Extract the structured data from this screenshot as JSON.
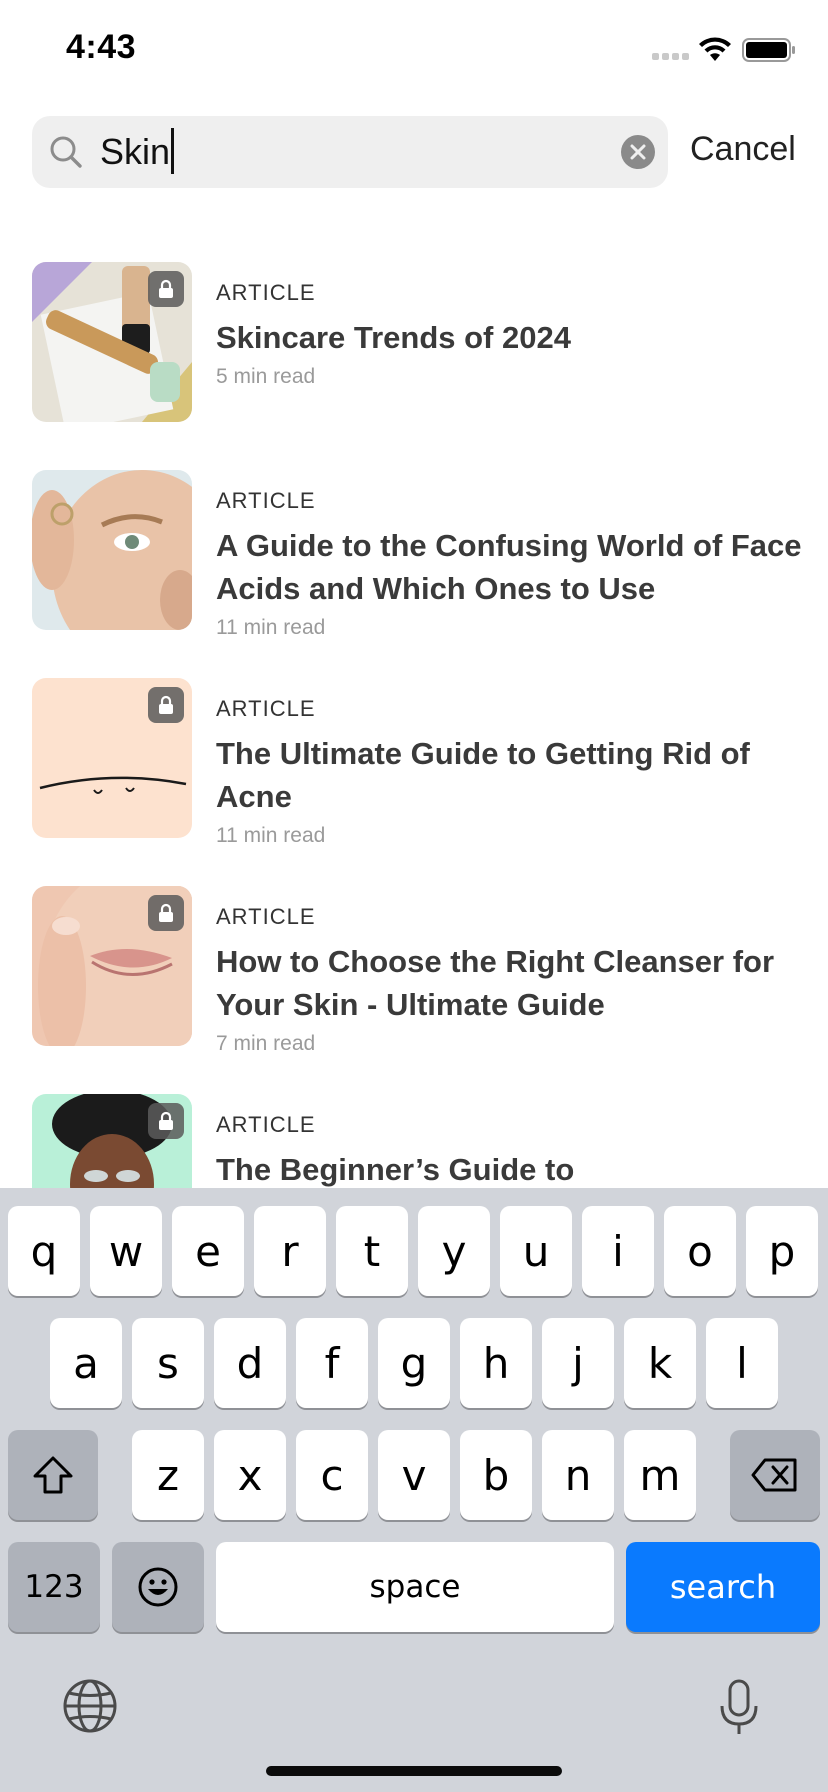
{
  "status_bar": {
    "time": "4:43",
    "signal_icon": "cellular-signal-icon",
    "wifi_icon": "wifi-icon",
    "battery_icon": "battery-icon"
  },
  "search": {
    "query": "Skin",
    "cancel_label": "Cancel"
  },
  "results": [
    {
      "kind": "ARTICLE",
      "title": "Skincare Trends of 2024",
      "read_time": "5 min read",
      "locked": true
    },
    {
      "kind": "ARTICLE",
      "title": "A Guide to the Confusing World of Face Acids and Which Ones to Use",
      "read_time": "11 min read",
      "locked": false
    },
    {
      "kind": "ARTICLE",
      "title": "The Ultimate Guide to Getting Rid of Acne",
      "read_time": "11 min read",
      "locked": true
    },
    {
      "kind": "ARTICLE",
      "title": "How to Choose the Right Cleanser for Your Skin - Ultimate Guide",
      "read_time": "7 min read",
      "locked": true
    },
    {
      "kind": "ARTICLE",
      "title": "The Beginner’s Guide to",
      "read_time": "",
      "locked": true
    }
  ],
  "keyboard": {
    "row1": [
      "q",
      "w",
      "e",
      "r",
      "t",
      "y",
      "u",
      "i",
      "o",
      "p"
    ],
    "row2": [
      "a",
      "s",
      "d",
      "f",
      "g",
      "h",
      "j",
      "k",
      "l"
    ],
    "row3": [
      "z",
      "x",
      "c",
      "v",
      "b",
      "n",
      "m"
    ],
    "numbers_label": "123",
    "space_label": "space",
    "search_label": "search",
    "accent_color": "#0a7afe"
  }
}
